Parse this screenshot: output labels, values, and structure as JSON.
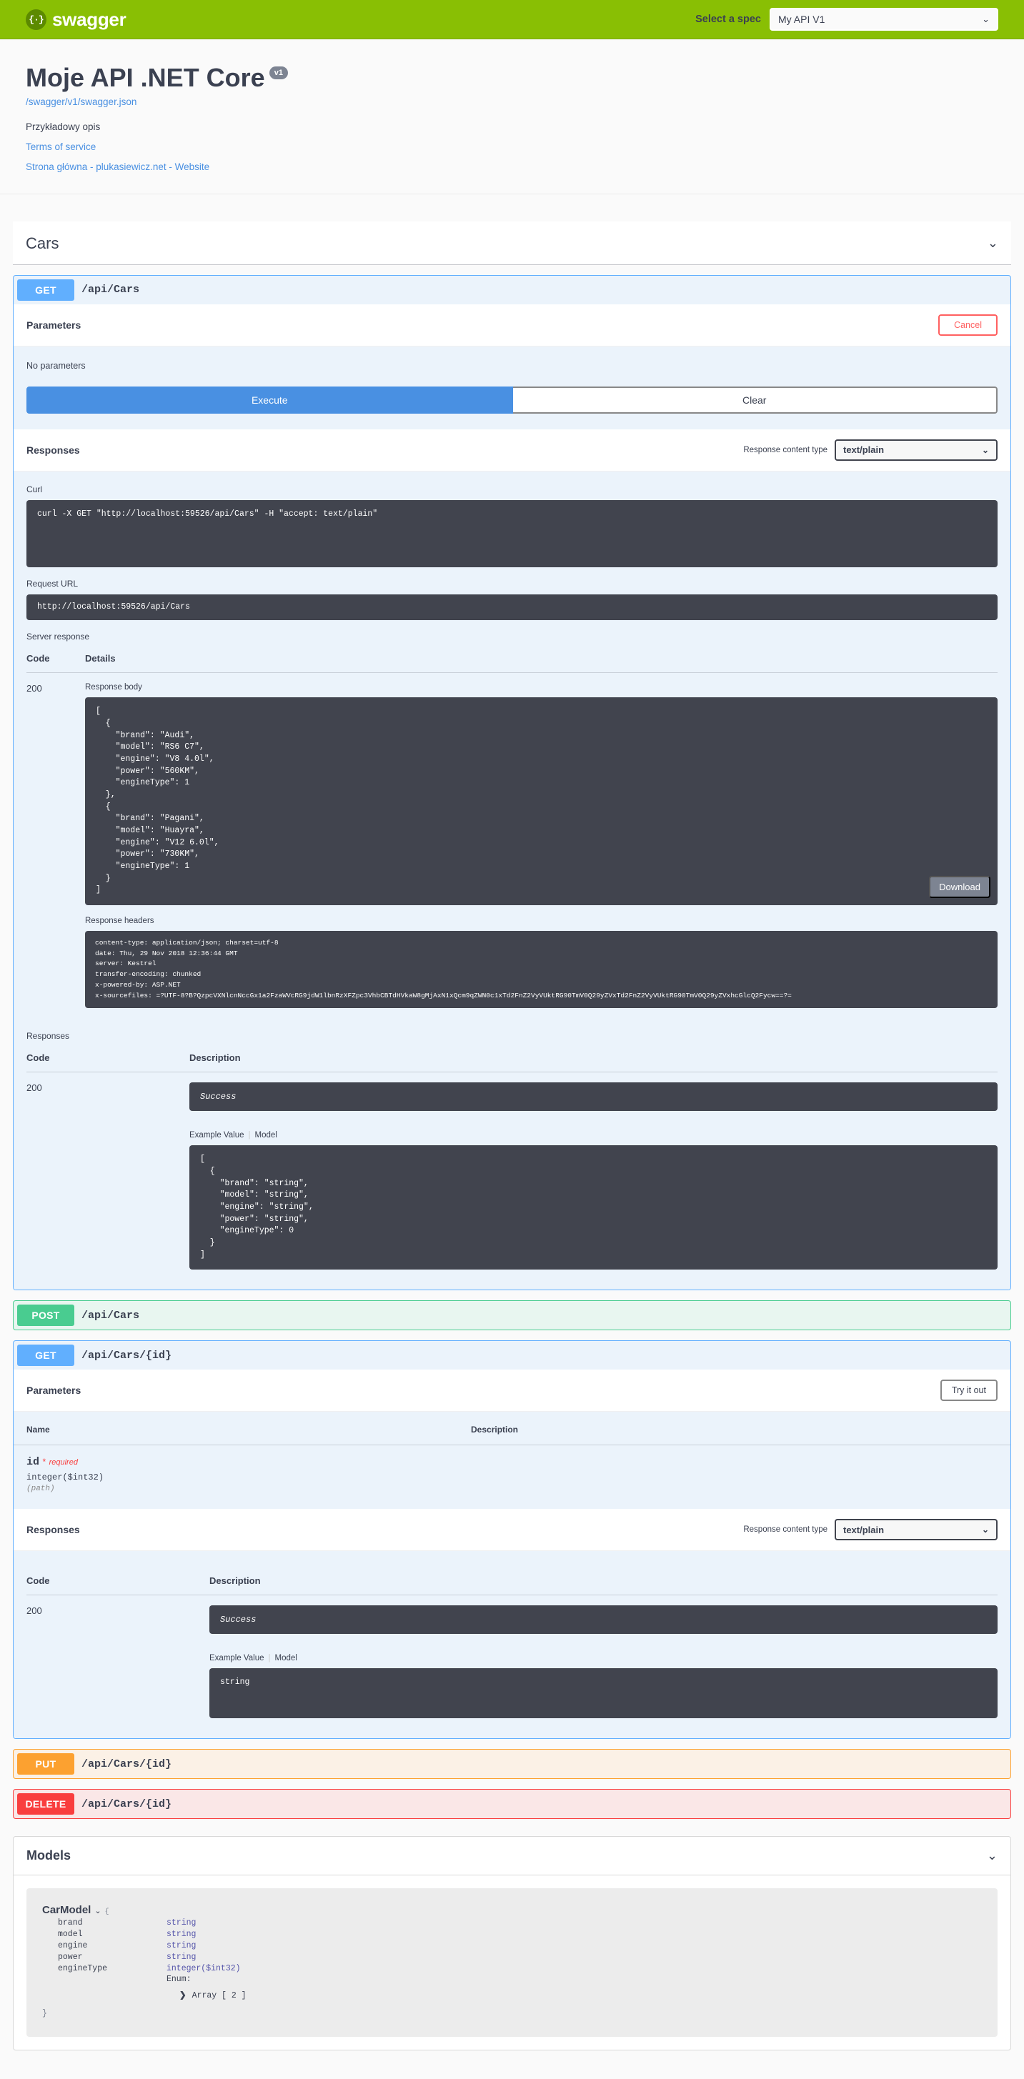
{
  "topbar": {
    "logo_text": "swagger",
    "logo_mark": "{·}",
    "spec_label": "Select a spec",
    "spec_value": "My API V1"
  },
  "info": {
    "title": "Moje API .NET Core",
    "version_badge": "v1",
    "spec_url": "/swagger/v1/swagger.json",
    "description": "Przykładowy opis",
    "terms_link": "Terms of service",
    "contact_link": "Strona główna - plukasiewicz.net - Website"
  },
  "tag": {
    "name": "Cars",
    "collapse_icon": "⌄"
  },
  "operations": [
    {
      "method": "GET",
      "path": "/api/Cars",
      "expanded": true,
      "parameters_title": "Parameters",
      "action_button": "Cancel",
      "no_parameters": "No parameters",
      "execute_label": "Execute",
      "clear_label": "Clear",
      "responses_title": "Responses",
      "content_type_label": "Response content type",
      "content_type_value": "text/plain",
      "curl_label": "Curl",
      "curl_value": "curl -X GET \"http://localhost:59526/api/Cars\" -H \"accept: text/plain\"",
      "request_url_label": "Request URL",
      "request_url_value": "http://localhost:59526/api/Cars",
      "server_response_label": "Server response",
      "server_table": {
        "code_header": "Code",
        "details_header": "Details"
      },
      "server_code": "200",
      "response_body_label": "Response body",
      "response_body": "[\n  {\n    \"brand\": \"Audi\",\n    \"model\": \"RS6 C7\",\n    \"engine\": \"V8 4.0l\",\n    \"power\": \"560KM\",\n    \"engineType\": 1\n  },\n  {\n    \"brand\": \"Pagani\",\n    \"model\": \"Huayra\",\n    \"engine\": \"V12 6.0l\",\n    \"power\": \"730KM\",\n    \"engineType\": 1\n  }\n]",
      "download_label": "Download",
      "response_headers_label": "Response headers",
      "response_headers": "content-type: application/json; charset=utf-8 \ndate: Thu, 29 Nov 2018 12:36:44 GMT \nserver: Kestrel \ntransfer-encoding: chunked \nx-powered-by: ASP.NET \nx-sourcefiles: =?UTF-8?B?QzpcVXNlcnNccGx1a2FzaWVcRG9jdW1lbnRzXFZpc3VhbCBTdHVkaW8gMjAxN1xQcm9qZWN0c1xTd2FnZ2VyVUktRG90TmV0Q29yZVxTd2FnZ2VyVUktRG90TmV0Q29yZVxhcGlcQ2Fycw==?=",
      "responses_list_title": "Responses",
      "resp_table": {
        "code_header": "Code",
        "desc_header": "Description"
      },
      "resp_code": "200",
      "resp_description": "Success",
      "example_tab": "Example Value",
      "model_tab": "Model",
      "example_value": "[\n  {\n    \"brand\": \"string\",\n    \"model\": \"string\",\n    \"engine\": \"string\",\n    \"power\": \"string\",\n    \"engineType\": 0\n  }\n]"
    },
    {
      "method": "POST",
      "path": "/api/Cars",
      "expanded": false
    },
    {
      "method": "GET",
      "path": "/api/Cars/{id}",
      "expanded": true,
      "parameters_title": "Parameters",
      "action_button": "Try it out",
      "param_table": {
        "name_header": "Name",
        "desc_header": "Description"
      },
      "param_name": "id",
      "param_required_star": "*",
      "param_required_text": "required",
      "param_type": "integer($int32)",
      "param_in": "(path)",
      "responses_title": "Responses",
      "content_type_label": "Response content type",
      "content_type_value": "text/plain",
      "resp_table": {
        "code_header": "Code",
        "desc_header": "Description"
      },
      "resp_code": "200",
      "resp_description": "Success",
      "example_tab": "Example Value",
      "model_tab": "Model",
      "example_value": "string"
    },
    {
      "method": "PUT",
      "path": "/api/Cars/{id}",
      "expanded": false
    },
    {
      "method": "DELETE",
      "path": "/api/Cars/{id}",
      "expanded": false
    }
  ],
  "models": {
    "title": "Models",
    "collapse_icon": "⌄",
    "model_name": "CarModel",
    "open_brace": "{",
    "close_brace": "}",
    "properties": [
      {
        "name": "brand",
        "type": "string"
      },
      {
        "name": "model",
        "type": "string"
      },
      {
        "name": "engine",
        "type": "string"
      },
      {
        "name": "power",
        "type": "string"
      },
      {
        "name": "engineType",
        "type": "integer($int32)"
      }
    ],
    "enum_label": "Enum:",
    "enum_array": "Array [ 2 ]",
    "enum_arrow": "❯"
  },
  "colors": {
    "brand_green": "#89bf04",
    "get_blue": "#61affe",
    "post_green": "#49cc90",
    "put_orange": "#fca130",
    "delete_red": "#f93e3e",
    "code_bg": "#41444e",
    "execute_blue": "#4990e2"
  }
}
